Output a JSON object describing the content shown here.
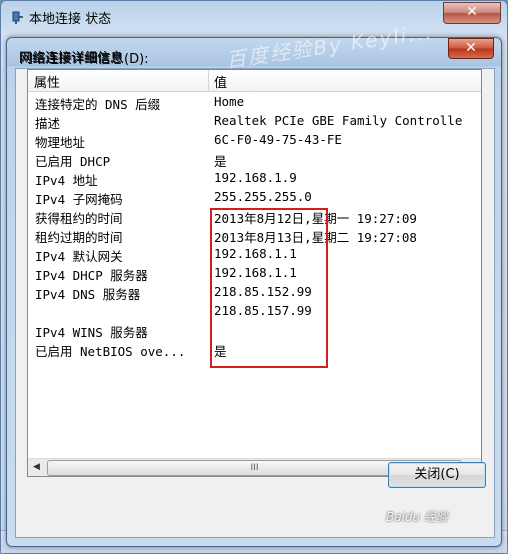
{
  "parent_window": {
    "title": "本地连接 状态",
    "close_label": "✕"
  },
  "dialog": {
    "title": "网络连接详细信息",
    "close_label": "✕",
    "list_label": "网络连接详细信息(D):",
    "columns": {
      "property": "属性",
      "value": "值"
    },
    "rows": [
      {
        "property": "连接特定的 DNS 后缀",
        "value": "Home"
      },
      {
        "property": "描述",
        "value": "Realtek PCIe GBE Family Controlle"
      },
      {
        "property": "物理地址",
        "value": "6C-F0-49-75-43-FE"
      },
      {
        "property": "已启用 DHCP",
        "value": "是"
      },
      {
        "property": "IPv4 地址",
        "value": "192.168.1.9"
      },
      {
        "property": "IPv4 子网掩码",
        "value": "255.255.255.0"
      },
      {
        "property": "获得租约的时间",
        "value": "2013年8月12日,星期一 19:27:09"
      },
      {
        "property": "租约过期的时间",
        "value": "2013年8月13日,星期二 19:27:08"
      },
      {
        "property": "IPv4 默认网关",
        "value": "192.168.1.1"
      },
      {
        "property": "IPv4 DHCP 服务器",
        "value": "192.168.1.1"
      },
      {
        "property": "IPv4 DNS 服务器",
        "value": "218.85.152.99"
      },
      {
        "property": "",
        "value": "218.85.157.99"
      },
      {
        "property": "IPv4 WINS 服务器",
        "value": ""
      },
      {
        "property": "已启用 NetBIOS ove...",
        "value": "是"
      }
    ],
    "close_button_label": "关闭(C)",
    "scroll_thumb_grip": "III",
    "scroll_left_arrow": "◀",
    "scroll_right_arrow": "▶"
  },
  "watermarks": {
    "top": "百度经验By Keyli...",
    "bottom": "Baidu 经验"
  },
  "colors": {
    "highlight_box": "#d11f1f",
    "close_button_red": "#c8462d"
  }
}
